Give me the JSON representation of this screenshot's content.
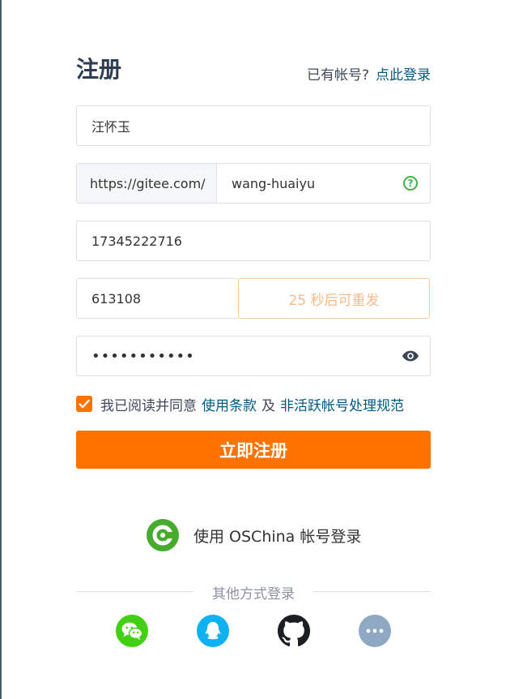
{
  "header": {
    "title": "注册",
    "login_prompt": "已有帐号?",
    "login_link": "点此登录"
  },
  "form": {
    "name_value": "汪怀玉",
    "url_prefix": "https://gitee.com/",
    "username_value": "wang-huaiyu",
    "phone_value": "17345222716",
    "code_value": "613108",
    "resend_label": "25 秒后可重发",
    "password_value": "•••••••••••"
  },
  "agreement": {
    "checked": true,
    "text": "我已阅读并同意",
    "terms_link": "使用条款",
    "and": "及",
    "policy_link": "非活跃帐号处理规范"
  },
  "submit_label": "立即注册",
  "oschina": {
    "label": "使用 OSChina 帐号登录"
  },
  "other_login": {
    "label": "其他方式登录",
    "providers": [
      "wechat-icon",
      "qq-icon",
      "github-icon",
      "more-icon"
    ]
  },
  "colors": {
    "accent": "#fe7300",
    "link": "#005980",
    "oschina_green": "#47ab2e",
    "wechat_green": "#41d014",
    "qq_blue": "#0fb1f0",
    "more_gray": "#8fa9c5"
  }
}
